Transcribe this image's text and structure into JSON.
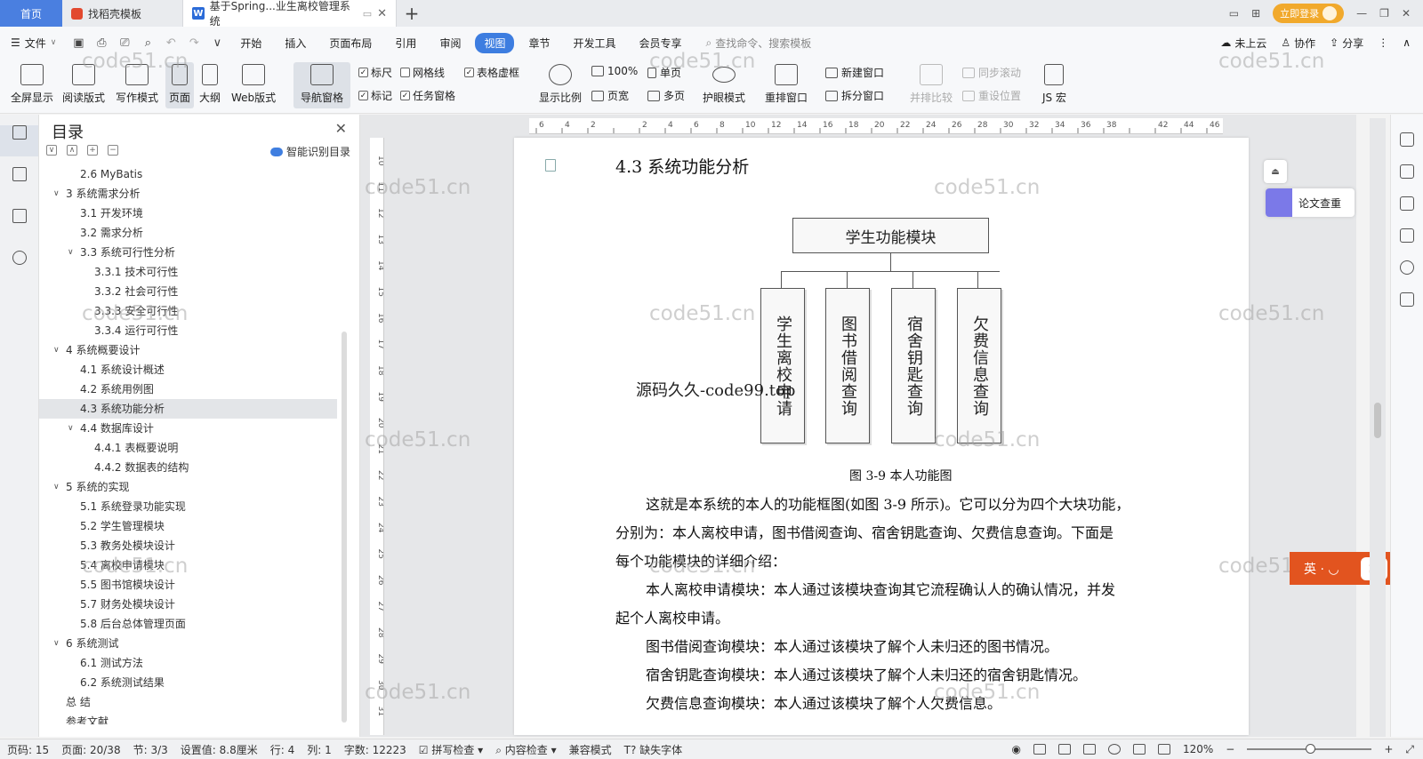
{
  "titlebar": {
    "home_tab": "首页",
    "tabs": [
      {
        "label": "找稻壳模板"
      },
      {
        "label": "基于Spring...业生离校管理系统"
      }
    ],
    "login_label": "立即登录"
  },
  "menubar": {
    "file_label": "文件",
    "items": [
      "开始",
      "插入",
      "页面布局",
      "引用",
      "审阅",
      "视图",
      "章节",
      "开发工具",
      "会员专享"
    ],
    "search_placeholder": "查找命令、搜索模板",
    "right": [
      "未上云",
      "协作",
      "分享"
    ]
  },
  "ribbon": {
    "big_buttons": [
      "全屏显示",
      "阅读版式",
      "写作模式",
      "页面",
      "大纲",
      "Web版式",
      "导航窗格"
    ],
    "checks": [
      {
        "label": "标尺",
        "checked": true
      },
      {
        "label": "网格线",
        "checked": false
      },
      {
        "label": "表格虚框",
        "checked": true
      },
      {
        "label": "标记",
        "checked": true
      },
      {
        "label": "任务窗格",
        "checked": true
      }
    ],
    "zoom": {
      "display_ratio": "显示比例",
      "hundred": "100%",
      "single_page": "单页",
      "page_width": "页宽",
      "multi_page": "多页"
    },
    "eye_mode": "护眼模式",
    "rearrange": "重排窗口",
    "new_window": "新建窗口",
    "split_window": "拆分窗口",
    "side_by_side": "并排比较",
    "sync_scroll": "同步滚动",
    "reset_pos": "重设位置",
    "js_macro": "JS 宏"
  },
  "toc": {
    "title": "目录",
    "smart_label": "智能识别目录",
    "items": [
      {
        "text": "2.6 MyBatis",
        "level": 2,
        "arrow": ""
      },
      {
        "text": "3  系统需求分析",
        "level": 1,
        "arrow": "v"
      },
      {
        "text": "3.1  开发环境",
        "level": 2,
        "arrow": ""
      },
      {
        "text": "3.2  需求分析",
        "level": 2,
        "arrow": ""
      },
      {
        "text": "3.3  系统可行性分析",
        "level": 2,
        "arrow": "v"
      },
      {
        "text": "3.3.1 技术可行性",
        "level": 3,
        "arrow": ""
      },
      {
        "text": "3.3.2 社会可行性",
        "level": 3,
        "arrow": ""
      },
      {
        "text": "3.3.3 安全可行性",
        "level": 3,
        "arrow": ""
      },
      {
        "text": "3.3.4 运行可行性",
        "level": 3,
        "arrow": ""
      },
      {
        "text": "4  系统概要设计",
        "level": 1,
        "arrow": "v"
      },
      {
        "text": "4.1  系统设计概述",
        "level": 2,
        "arrow": ""
      },
      {
        "text": "4.2  系统用例图",
        "level": 2,
        "arrow": ""
      },
      {
        "text": "4.3  系统功能分析",
        "level": 2,
        "arrow": "",
        "selected": true
      },
      {
        "text": "4.4  数据库设计",
        "level": 2,
        "arrow": "v"
      },
      {
        "text": "4.4.1 表概要说明",
        "level": 3,
        "arrow": ""
      },
      {
        "text": "4.4.2  数据表的结构",
        "level": 3,
        "arrow": ""
      },
      {
        "text": "5    系统的实现",
        "level": 1,
        "arrow": "v"
      },
      {
        "text": "5.1  系统登录功能实现",
        "level": 2,
        "arrow": ""
      },
      {
        "text": "5.2  学生管理模块",
        "level": 2,
        "arrow": ""
      },
      {
        "text": "5.3  教务处模块设计",
        "level": 2,
        "arrow": ""
      },
      {
        "text": "5.4  离校申请模块",
        "level": 2,
        "arrow": ""
      },
      {
        "text": "5.5  图书馆模块设计",
        "level": 2,
        "arrow": ""
      },
      {
        "text": "5.7  财务处模块设计",
        "level": 2,
        "arrow": ""
      },
      {
        "text": "5.8  后台总体管理页面",
        "level": 2,
        "arrow": ""
      },
      {
        "text": "6    系统测试",
        "level": 1,
        "arrow": "v"
      },
      {
        "text": "6.1  测试方法",
        "level": 2,
        "arrow": ""
      },
      {
        "text": "6.2  系统测试结果",
        "level": 2,
        "arrow": ""
      },
      {
        "text": "总  结",
        "level": 1,
        "arrow": ""
      },
      {
        "text": "参考文献",
        "level": 1,
        "arrow": ""
      }
    ]
  },
  "ruler": {
    "h_ticks": [
      "6",
      "4",
      "2",
      "",
      "2",
      "4",
      "6",
      "8",
      "10",
      "12",
      "14",
      "16",
      "18",
      "20",
      "22",
      "24",
      "26",
      "28",
      "30",
      "32",
      "34",
      "36",
      "38",
      "",
      "42",
      "44",
      "46"
    ],
    "v_ticks": [
      "10",
      "11",
      "12",
      "13",
      "14",
      "15",
      "16",
      "17",
      "18",
      "19",
      "20",
      "21",
      "22",
      "23",
      "24",
      "25",
      "26",
      "27",
      "28",
      "29",
      "30",
      "31"
    ]
  },
  "document": {
    "section_title": "4.3  系统功能分析",
    "diagram": {
      "top": "学生功能模块",
      "children": [
        "学生离校申请",
        "图书借阅查询",
        "宿舍钥匙查询",
        "欠费信息查询"
      ]
    },
    "source_mark": "源码久久-code99.top",
    "caption": "图 3-9  本人功能图",
    "paragraphs": [
      "这就是本系统的本人的功能框图(如图 3-9 所示)。它可以分为四个大块功能，",
      "分别为：本人离校申请，图书借阅查询、宿舍钥匙查询、欠费信息查询。下面是",
      "每个功能模块的详细介绍：",
      "本人离校申请模块：本人通过该模块查询其它流程确认人的确认情况，并发",
      "起个人离校申请。",
      "图书借阅查询模块：本人通过该模块了解个人未归还的图书情况。",
      "宿舍钥匙查询模块：本人通过该模块了解个人未归还的宿舍钥匙情况。",
      "欠费信息查询模块：本人通过该模块了解个人欠费信息。"
    ]
  },
  "watermark": "code51.cn",
  "side": {
    "check_label": "论文查重",
    "ime_label": "英 · ◡"
  },
  "status": {
    "page_code": "页码: 15",
    "page": "页面: 20/38",
    "section": "节: 3/3",
    "setting": "设置值: 8.8厘米",
    "row": "行: 4",
    "col": "列: 1",
    "words": "字数: 12223",
    "spell": "拼写检查",
    "content": "内容检查",
    "compat": "兼容模式",
    "missing_font": "缺失字体",
    "zoom": "120%"
  }
}
